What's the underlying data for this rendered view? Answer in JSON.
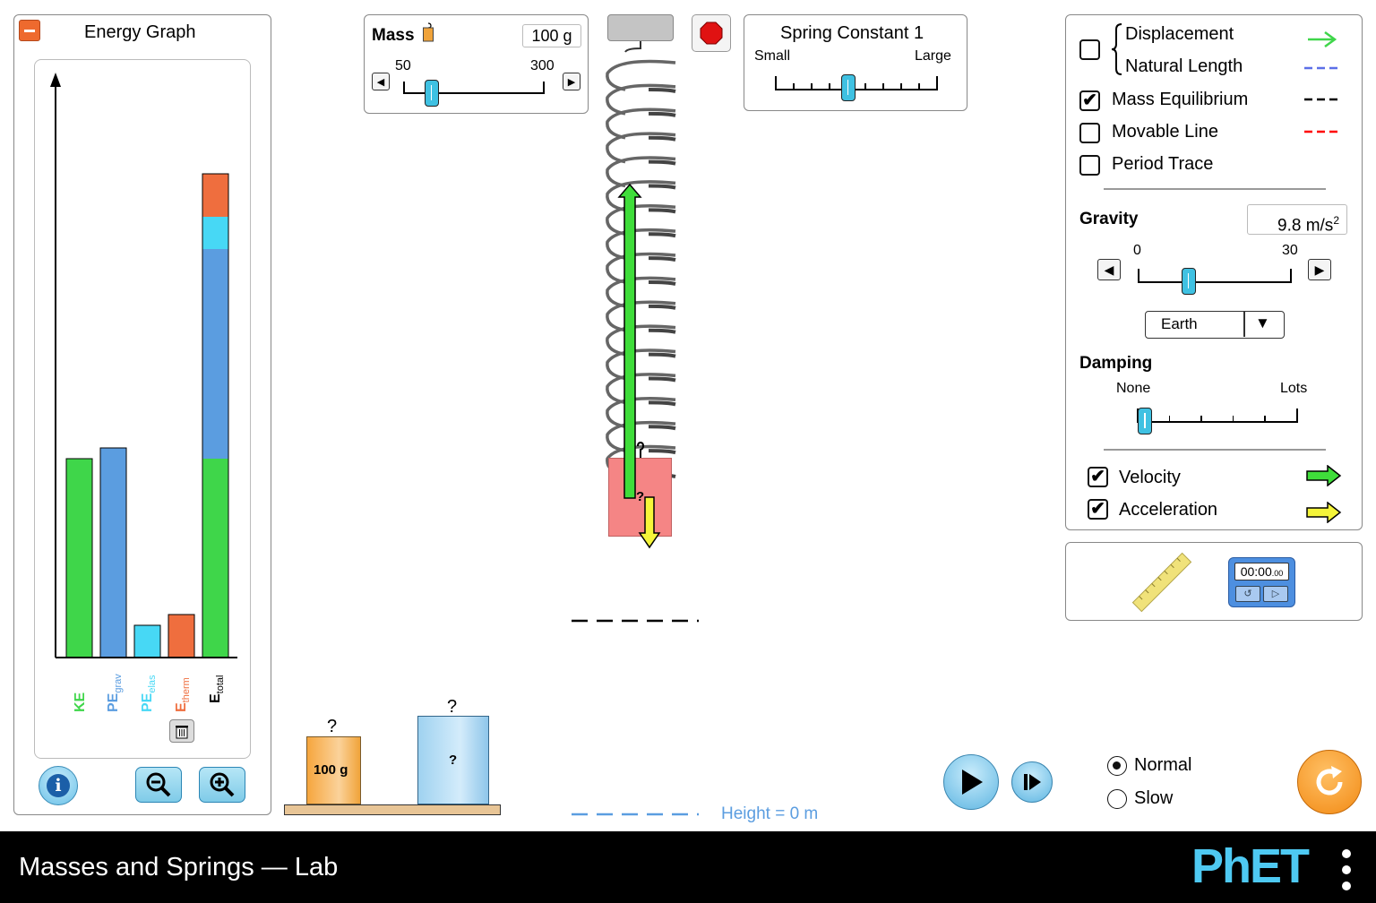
{
  "energy_graph": {
    "title": "Energy Graph",
    "bars": [
      {
        "label": "KE",
        "sub": "",
        "color": "#3fd64a",
        "value": 0.37
      },
      {
        "label": "PE",
        "sub": "grav",
        "color": "#5b9de0",
        "value": 0.39
      },
      {
        "label": "PE",
        "sub": "elas",
        "color": "#47d8f5",
        "value": 0.06
      },
      {
        "label": "E",
        "sub": "therm",
        "color": "#ef6e3e",
        "value": 0.08
      },
      {
        "label": "E",
        "sub": "total",
        "color": "#000000",
        "value": 0.9
      }
    ]
  },
  "mass_panel": {
    "title": "Mass",
    "value": "100 g",
    "min": "50",
    "max": "300",
    "level": 0.2
  },
  "spring_constant": {
    "title": "Spring Constant 1",
    "min_label": "Small",
    "max_label": "Large",
    "level": 0.45
  },
  "options": {
    "displacement": "Displacement",
    "natural_length": "Natural Length",
    "mass_equilibrium": "Mass Equilibrium",
    "movable_line": "Movable Line",
    "period_trace": "Period Trace",
    "displacement_checked": false,
    "mass_equilibrium_checked": true,
    "movable_line_checked": false,
    "period_trace_checked": false,
    "colors": {
      "displacement": "#3fd64a",
      "natural_length": "#5b6fe8",
      "mass_equilibrium": "#000000",
      "movable_line": "#ff0000"
    }
  },
  "gravity": {
    "title": "Gravity",
    "value": "9.8 m/s",
    "sup": "2",
    "min": "0",
    "max": "30",
    "level": 0.33,
    "planet": "Earth"
  },
  "damping": {
    "title": "Damping",
    "min_label": "None",
    "max_label": "Lots",
    "level": 0.05
  },
  "vectors": {
    "velocity": "Velocity",
    "acceleration": "Acceleration",
    "velocity_checked": true,
    "acceleration_checked": true
  },
  "stopwatch": {
    "time": "00:00",
    "hundredths": ".00"
  },
  "masses": [
    {
      "label": "100 g",
      "hook": "?"
    },
    {
      "label": "?",
      "hook": "?"
    }
  ],
  "hanging_mass": {
    "label": "?"
  },
  "height_label": "Height = 0 m",
  "time_speed": {
    "normal": "Normal",
    "slow": "Slow",
    "selected": "Normal"
  },
  "footer": {
    "title": "Masses and Springs — Lab",
    "logo": "PhET"
  }
}
